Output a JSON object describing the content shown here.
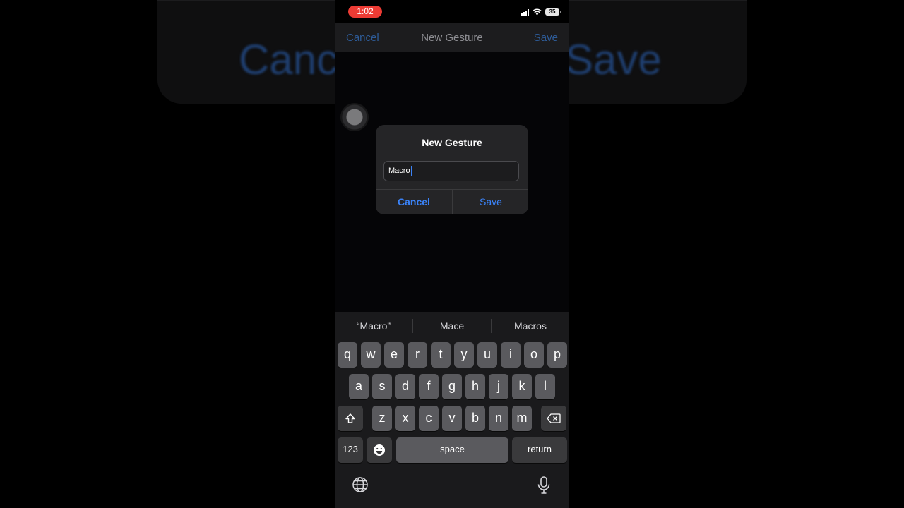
{
  "background": {
    "cancel_label": "Canc",
    "save_label": "Save"
  },
  "status_bar": {
    "time": "1:02",
    "battery_level": "35",
    "icons": [
      "cellular-signal-icon",
      "wifi-icon",
      "battery-icon"
    ],
    "time_pill_color": "#ec3b34"
  },
  "navbar": {
    "cancel_label": "Cancel",
    "title": "New Gesture",
    "save_label": "Save"
  },
  "dialog": {
    "title": "New Gesture",
    "input_value": "Macro",
    "cancel_label": "Cancel",
    "save_label": "Save",
    "accent_color": "#3a82f7"
  },
  "keyboard": {
    "suggestions": [
      "“Macro”",
      "Mace",
      "Macros"
    ],
    "row1": [
      "q",
      "w",
      "e",
      "r",
      "t",
      "y",
      "u",
      "i",
      "o",
      "p"
    ],
    "row2": [
      "a",
      "s",
      "d",
      "f",
      "g",
      "h",
      "j",
      "k",
      "l"
    ],
    "row3": [
      "z",
      "x",
      "c",
      "v",
      "b",
      "n",
      "m"
    ],
    "shift_icon": "shift-icon",
    "delete_icon": "backspace-icon",
    "numbers_label": "123",
    "emoji_icon": "emoji-icon",
    "space_label": "space",
    "return_label": "return",
    "globe_icon": "globe-icon",
    "mic_icon": "microphone-icon"
  }
}
